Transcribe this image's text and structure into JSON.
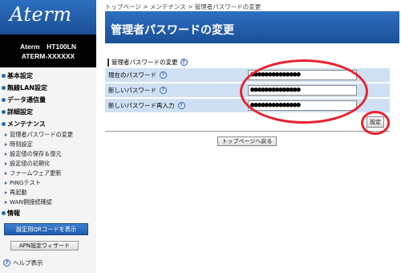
{
  "sidebar": {
    "logo": "Aterm",
    "model_line1": "Aterm　HT100LN",
    "model_line2": "ATERM-XXXXXX",
    "groups": [
      {
        "label": "基本設定"
      },
      {
        "label": "無線LAN設定"
      },
      {
        "label": "データ通信量"
      },
      {
        "label": "詳細設定"
      },
      {
        "label": "メンテナンス"
      }
    ],
    "maintenance_items": [
      {
        "label": "管理者パスワードの変更"
      },
      {
        "label": "時刻設定"
      },
      {
        "label": "設定値の保存＆復元"
      },
      {
        "label": "設定値の初期化"
      },
      {
        "label": "ファームウェア更新"
      },
      {
        "label": "PINGテスト"
      },
      {
        "label": "再起動"
      },
      {
        "label": "WAN側接続確認"
      }
    ],
    "info_label": "情報",
    "qr_button": "設定用QRコードを表示",
    "apn_button": "APN設定ウィザード",
    "help_label": "ヘルプ表示",
    "help_icon_glyph": "?"
  },
  "main": {
    "breadcrumb": "トップページ > メンテナンス > 管理者パスワードの変更",
    "title": "管理者パスワードの変更",
    "section_label": "管理者パスワードの変更",
    "form": {
      "rows": [
        {
          "label": "現在のパスワード",
          "value": "●●●●●●●●●●●●●●"
        },
        {
          "label": "新しいパスワード",
          "value": "●●●●●●●●●●●●●●"
        },
        {
          "label": "新しいパスワード再入力",
          "value": "●●●●●●●●●●●●●●"
        }
      ]
    },
    "set_button": "設定",
    "top_button": "トップページへ戻る"
  },
  "colors": {
    "brand_blue": "#1b4f97",
    "row_bg": "#cfe0f2",
    "annotation_red": "#e8222f"
  }
}
